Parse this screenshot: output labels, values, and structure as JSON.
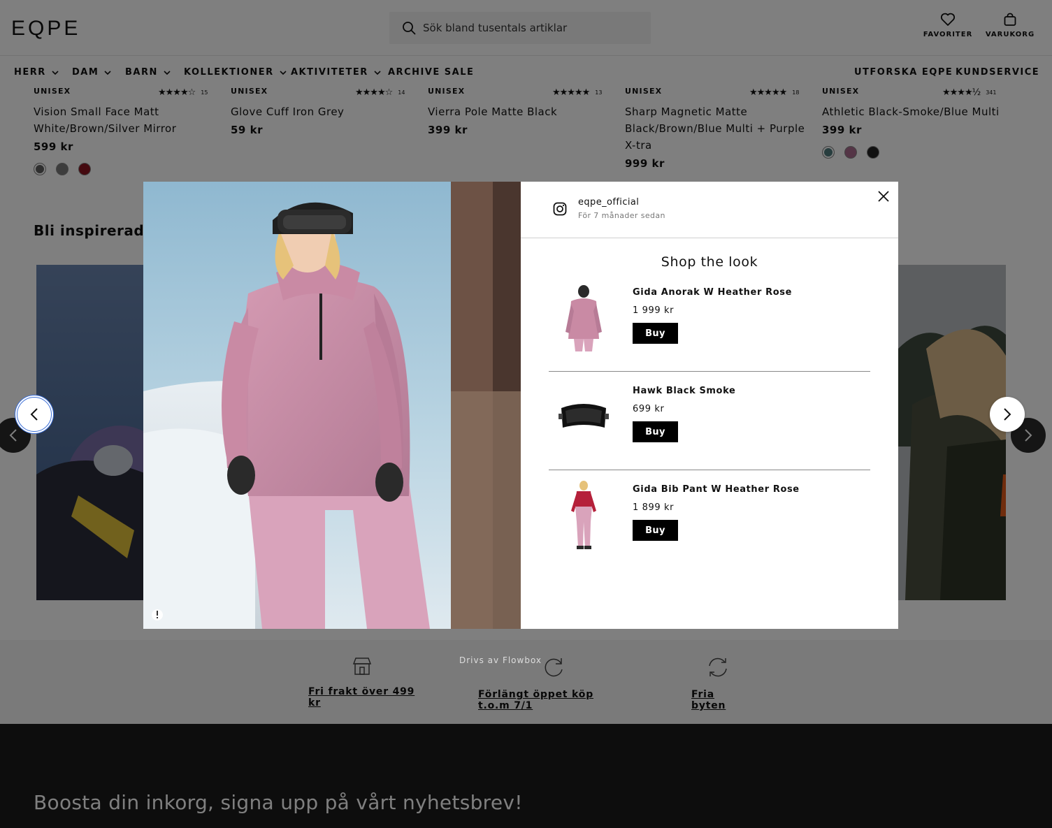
{
  "header": {
    "logo": "EQPE",
    "search_placeholder": "Sök bland tusentals artiklar",
    "favorites_label": "FAVORITER",
    "cart_label": "VARUKORG"
  },
  "nav": {
    "items": [
      "HERR",
      "DAM",
      "BARN",
      "KOLLEKTIONER",
      "AKTIVITETER",
      "ARCHIVE SALE"
    ],
    "right_items": [
      "UTFORSKA EQPE",
      "KUNDSERVICE"
    ]
  },
  "products": [
    {
      "gender": "UNISEX",
      "rating": 4,
      "reviews": "15",
      "name": "Vision Small Face Matt White/Brown/Silver Mirror",
      "price": "599 kr",
      "swatches": [
        "#5e5e5e",
        "#7a7a7a",
        "#8a1520"
      ]
    },
    {
      "gender": "UNISEX",
      "rating": 4,
      "reviews": "14",
      "name": "Glove Cuff Iron Grey",
      "price": "59 kr",
      "swatches": []
    },
    {
      "gender": "UNISEX",
      "rating": 5,
      "reviews": "13",
      "name": "Vierra Pole Matte Black",
      "price": "399 kr",
      "swatches": []
    },
    {
      "gender": "UNISEX",
      "rating": 5,
      "reviews": "18",
      "name": "Sharp Magnetic Matte Black/Brown/Blue Multi + Purple X-tra",
      "price": "999 kr",
      "swatches": []
    },
    {
      "gender": "UNISEX",
      "rating": 4.5,
      "reviews": "341",
      "name": "Athletic Black-Smoke/Blue Multi",
      "price": "399 kr",
      "swatches": [
        "#4f7b7d",
        "#a86a8c",
        "#222222"
      ]
    }
  ],
  "inspiration_title": "Bli inspirerad av",
  "modal": {
    "username": "eqpe_official",
    "time": "För 7 månader sedan",
    "shop_title": "Shop the look",
    "items": [
      {
        "name": "Gida Anorak W Heather Rose",
        "price": "1 999 kr",
        "button": "Buy"
      },
      {
        "name": "Hawk Black Smoke",
        "price": "699 kr",
        "button": "Buy"
      },
      {
        "name": "Gida Bib Pant W Heather Rose",
        "price": "1 899 kr",
        "button": "Buy"
      }
    ],
    "powered_by": "Drivs av Flowbox"
  },
  "usp": [
    {
      "label": "Fri frakt över 499 kr",
      "icon": "store-icon"
    },
    {
      "label": "Förlängt öppet köp t.o.m 7/1",
      "icon": "refresh-icon"
    },
    {
      "label": "Fria byten",
      "icon": "exchange-icon"
    }
  ],
  "footer": {
    "newsletter_title": "Boosta din inkorg, signa upp på vårt nyhetsbrev!"
  },
  "colors": {
    "accent": "#000000",
    "focus_ring": "#3b6fd8",
    "modal_jacket": "#c98aa4"
  }
}
